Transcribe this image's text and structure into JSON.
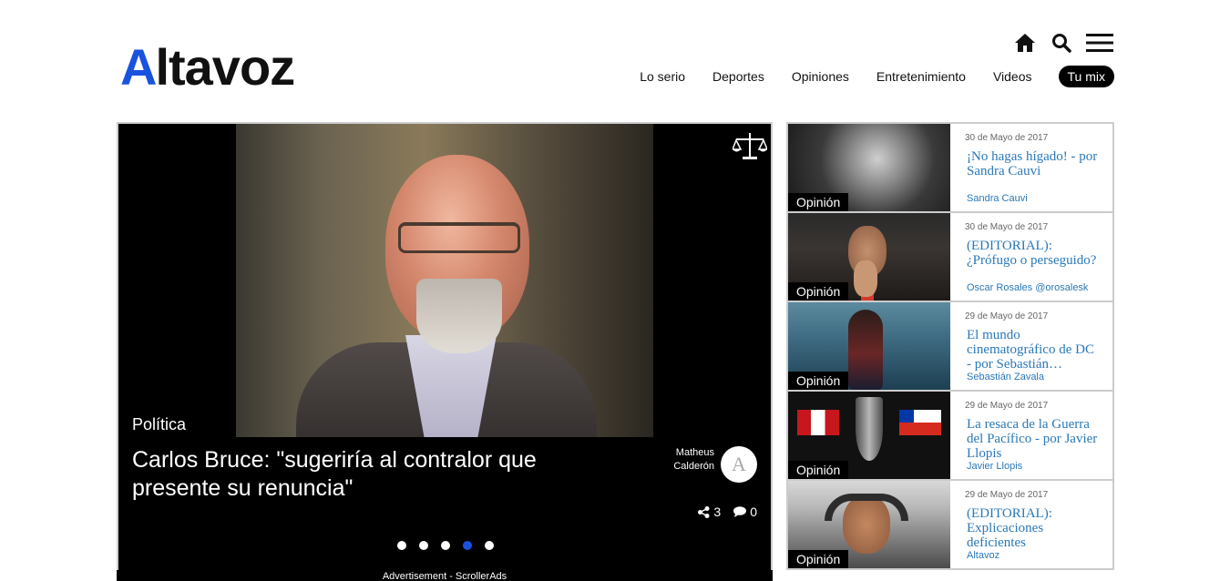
{
  "header": {
    "logo_first": "A",
    "logo_rest": "ltavoz",
    "nav": [
      "Lo serio",
      "Deportes",
      "Opiniones",
      "Entretenimiento",
      "Videos"
    ],
    "nav_mix": "Tu mix"
  },
  "hero": {
    "category": "Política",
    "title": "Carlos Bruce: \"sugeriría al contralor que presente su renuncia\"",
    "author": "Matheus Calderón",
    "avatar_letter": "A",
    "shares": "3",
    "comments": "0",
    "dots_count": 5,
    "active_dot": 4,
    "ad_text": "Advertisement - ScrollerAds"
  },
  "sidebar": {
    "items": [
      {
        "tag": "Opinión",
        "date": "30 de Mayo de 2017",
        "title": "¡No hagas hígado! - por Sandra Cauvi",
        "author": "Sandra Cauvi"
      },
      {
        "tag": "Opinión",
        "date": "30 de Mayo de 2017",
        "title": "(EDITORIAL): ¿Prófugo o perseguido?",
        "author": "Oscar Rosales @orosalesk"
      },
      {
        "tag": "Opinión",
        "date": "29 de Mayo de 2017",
        "title": "El mundo cinematográfico de DC - por Sebastián…",
        "author": "Sebastián Zavala"
      },
      {
        "tag": "Opinión",
        "date": "29 de Mayo de 2017",
        "title": "La resaca de la Guerra del Pacífico - por Javier Llopis",
        "author": "Javier Llopis"
      },
      {
        "tag": "Opinión",
        "date": "29 de Mayo de 2017",
        "title": "(EDITORIAL): Explicaciones deficientes",
        "author": "Altavoz"
      }
    ]
  },
  "colors": {
    "accent": "#1a52e0",
    "link": "#2a78b8"
  }
}
